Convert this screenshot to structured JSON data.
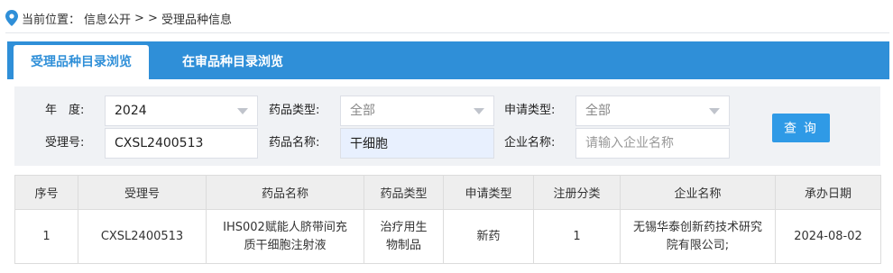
{
  "breadcrumb": {
    "icon": "location-pin-icon",
    "prefix": "当前位置：",
    "section": "信息公开",
    "separator": "> >",
    "current": "受理品种信息"
  },
  "tabs": [
    {
      "label": "受理品种目录浏览",
      "active": true
    },
    {
      "label": "在审品种目录浏览",
      "active": false
    }
  ],
  "filters": {
    "year": {
      "label": "年　度:",
      "value": "2024"
    },
    "drug_type": {
      "label": "药品类型:",
      "value": "全部"
    },
    "application_type": {
      "label": "申请类型:",
      "value": "全部"
    },
    "acceptance_no": {
      "label": "受理号:",
      "value": "CXSL2400513"
    },
    "drug_name": {
      "label": "药品名称:",
      "value": "干细胞"
    },
    "company_name": {
      "label": "企业名称:",
      "value": "",
      "placeholder": "请输入企业名称"
    },
    "query_button": "查 询"
  },
  "table": {
    "headers": [
      "序号",
      "受理号",
      "药品名称",
      "药品类型",
      "申请类型",
      "注册分类",
      "企业名称",
      "承办日期"
    ],
    "rows": [
      {
        "index": "1",
        "acceptance_no": "CXSL2400513",
        "drug_name": "IHS002赋能人脐带间充质干细胞注射液",
        "drug_type": "治疗用生物制品",
        "application_type": "新药",
        "registration_class": "1",
        "company": "无锡华泰创新药技术研究院有限公司;",
        "date": "2024-08-02"
      }
    ]
  },
  "colors": {
    "accent": "#2f8fd8",
    "button": "#2f9ae6",
    "panel": "#f0f2f5"
  }
}
